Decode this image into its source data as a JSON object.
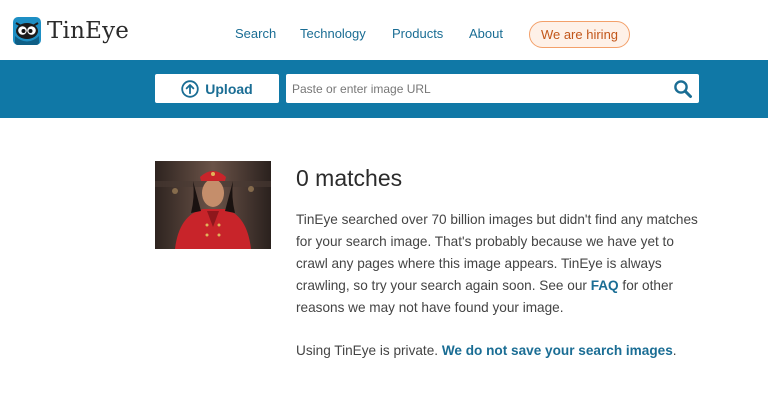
{
  "brand": {
    "name": "TinEye",
    "logo_icon": "tineye-mascot-icon"
  },
  "nav": {
    "search": "Search",
    "technology": "Technology",
    "products": "Products",
    "about": "About",
    "hiring": "We are hiring"
  },
  "search_bar": {
    "upload_label": "Upload",
    "upload_icon": "upload-arrow-icon",
    "url_placeholder": "Paste or enter image URL",
    "search_icon": "magnifier-icon"
  },
  "result": {
    "title": "0 matches",
    "description_before_link": "TinEye searched over 70 billion images but didn't find any matches for your search image. That's probably because we have yet to crawl any pages where this image appears. TinEye is always crawling, so try your search again soon. See our ",
    "faq_link": "FAQ",
    "description_after_link": " for other reasons we may not have found your image.",
    "privacy_text": "Using TinEye is private. ",
    "privacy_link": "We do not save your search images",
    "privacy_end": "."
  },
  "colors": {
    "brand_blue": "#1078a6",
    "link_blue": "#1a6d94",
    "hiring_orange": "#c2561a"
  }
}
